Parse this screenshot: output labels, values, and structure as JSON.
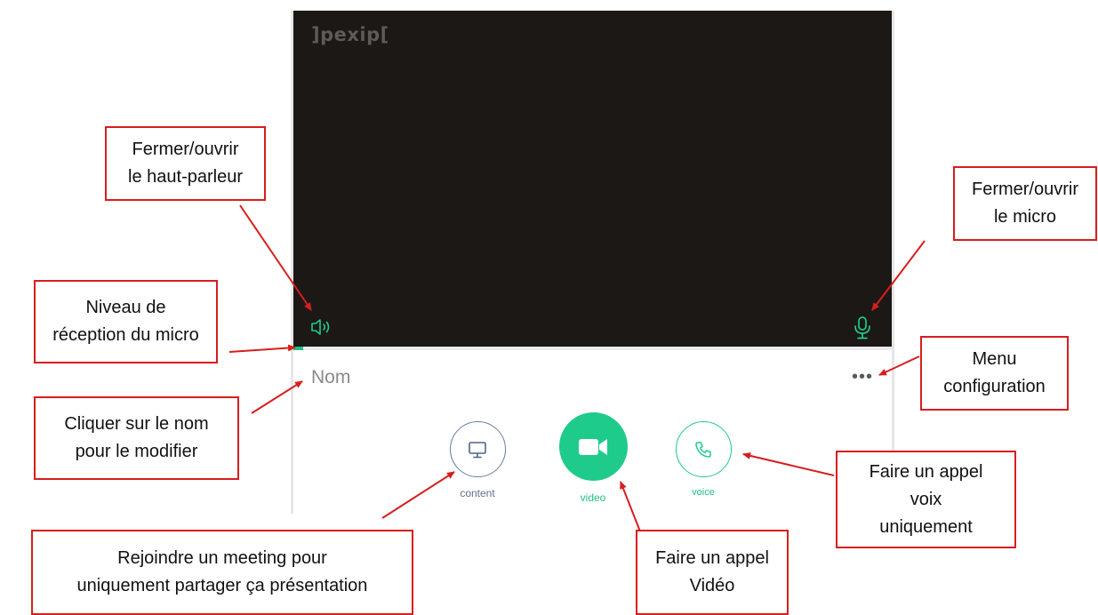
{
  "app": {
    "logo": "]pexip[",
    "name_placeholder": "Nom",
    "menu_glyph": "•••",
    "buttons": {
      "content": "content",
      "video": "video",
      "voice": "voice"
    },
    "mic_level": 0.016
  },
  "annotations": {
    "speaker": "Fermer/ouvrir\nle haut-parleur",
    "mic": "Fermer/ouvrir\nle micro",
    "level": "Niveau de\nréception du micro",
    "name": "Cliquer sur le nom\npour le modifier",
    "menu": "Menu\nconfiguration",
    "content": "Rejoindre un meeting pour\nuniquement partager ça présentation",
    "video": "Faire un appel\nVidéo",
    "voice": "Faire un appel\nvoix\nuniquement"
  },
  "colors": {
    "accent_green": "#1fcb8a",
    "content_blue": "#6b7d9e",
    "video_bg": "#1b1816",
    "annotation_red": "#d71e1e"
  },
  "icons": [
    "speaker-icon",
    "microphone-icon",
    "monitor-icon",
    "video-camera-icon",
    "phone-icon",
    "more-options-icon"
  ]
}
